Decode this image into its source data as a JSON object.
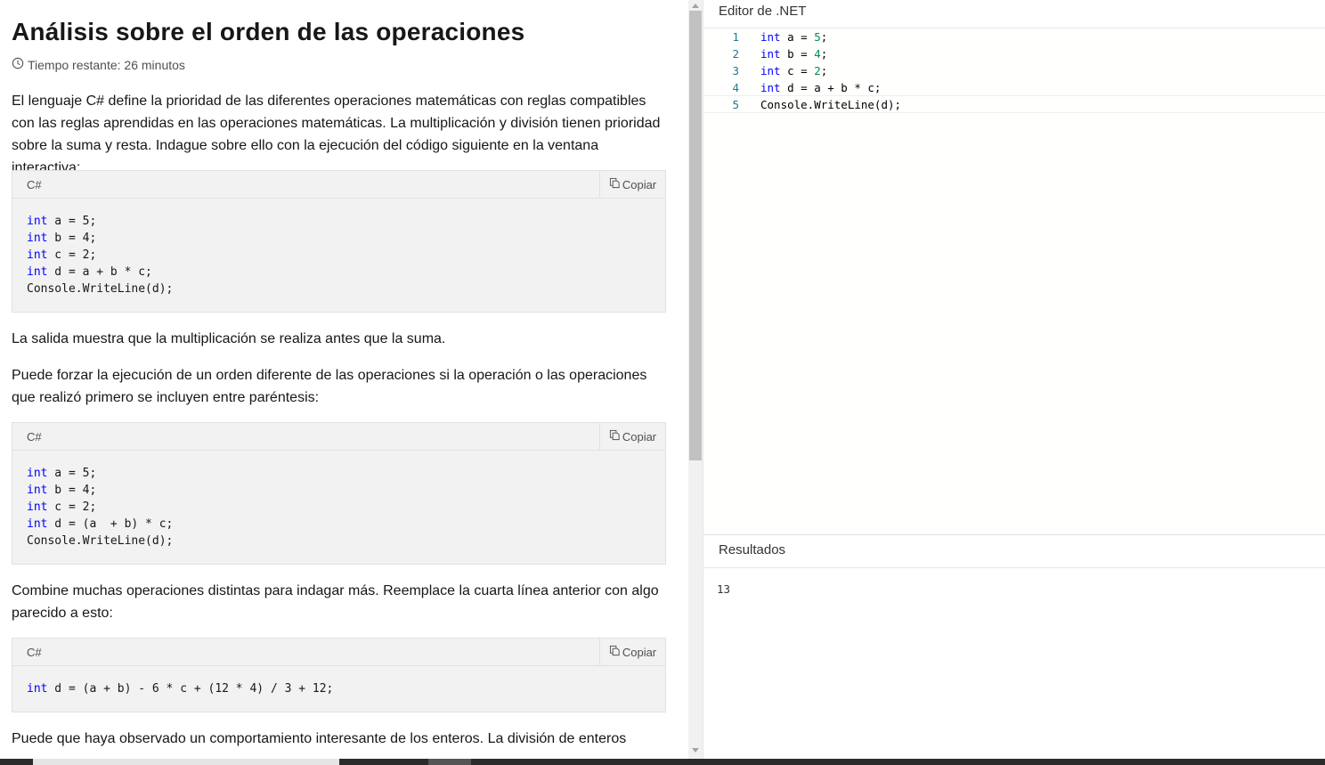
{
  "article": {
    "title": "Análisis sobre el orden de las operaciones",
    "time_remaining": "Tiempo restante: 26 minutos",
    "intro": "El lenguaje C# define la prioridad de las diferentes operaciones matemáticas con reglas compatibles con las reglas aprendidas en las operaciones matemáticas. La multiplicación y división tienen prioridad sobre la suma y resta. Indague sobre ello con la ejecución del código siguiente en la ventana interactiva:",
    "output_note": "La salida muestra que la multiplicación se realiza antes que la suma.",
    "parens_note": "Puede forzar la ejecución de un orden diferente de las operaciones si la operación o las operaciones que realizó primero se incluyen entre paréntesis:",
    "combine_note": "Combine muchas operaciones distintas para indagar más. Reemplace la cuarta línea anterior con algo parecido a esto:",
    "integer_note": "Puede que haya observado un comportamiento interesante de los enteros. La división de enteros",
    "code_blocks": [
      {
        "lang": "C#",
        "copy_label": "Copiar",
        "lines": [
          {
            "kw": "int",
            "rest": " a = 5;"
          },
          {
            "kw": "int",
            "rest": " b = 4;"
          },
          {
            "kw": "int",
            "rest": " c = 2;"
          },
          {
            "kw": "int",
            "rest": " d = a + b * c;"
          },
          {
            "kw": "",
            "rest": "Console.WriteLine(d);"
          }
        ]
      },
      {
        "lang": "C#",
        "copy_label": "Copiar",
        "lines": [
          {
            "kw": "int",
            "rest": " a = 5;"
          },
          {
            "kw": "int",
            "rest": " b = 4;"
          },
          {
            "kw": "int",
            "rest": " c = 2;"
          },
          {
            "kw": "int",
            "rest": " d = (a  + b) * c;"
          },
          {
            "kw": "",
            "rest": "Console.WriteLine(d);"
          }
        ]
      },
      {
        "lang": "C#",
        "copy_label": "Copiar",
        "lines": [
          {
            "kw": "int",
            "rest": " d = (a + b) - 6 * c + (12 * 4) / 3 + 12;"
          }
        ]
      }
    ]
  },
  "editor": {
    "title": "Editor de .NET",
    "lines": [
      {
        "num": "1",
        "kw": "int",
        "pre": " a = ",
        "n": "5",
        "post": ";"
      },
      {
        "num": "2",
        "kw": "int",
        "pre": " b = ",
        "n": "4",
        "post": ";"
      },
      {
        "num": "3",
        "kw": "int",
        "pre": " c = ",
        "n": "2",
        "post": ";"
      },
      {
        "num": "4",
        "kw": "int",
        "pre": " d = a + b * c;",
        "n": "",
        "post": ""
      },
      {
        "num": "5",
        "kw": "",
        "pre": "Console.WriteLine(d);",
        "n": "",
        "post": ""
      }
    ]
  },
  "results": {
    "title": "Resultados",
    "output": "13"
  },
  "icons": {
    "clock": "clock-icon",
    "copy": "copy-icon"
  },
  "colors": {
    "keyword": "#0000ff",
    "number": "#098658",
    "line_number": "#237893"
  }
}
